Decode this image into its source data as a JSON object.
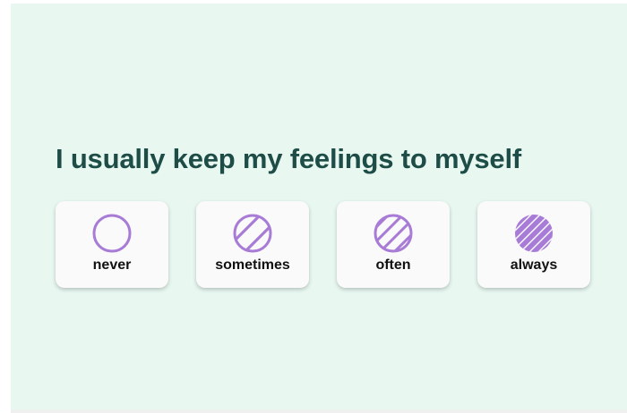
{
  "question": {
    "text": "I usually keep my feelings to myself"
  },
  "options": [
    {
      "label": "never",
      "icon": "empty-circle-icon",
      "fill_level": 0
    },
    {
      "label": "sometimes",
      "icon": "lightly-hatched-circle-icon",
      "fill_level": 1
    },
    {
      "label": "often",
      "icon": "hatched-circle-icon",
      "fill_level": 2
    },
    {
      "label": "always",
      "icon": "densely-hatched-circle-icon",
      "fill_level": 3
    }
  ],
  "colors": {
    "background": "#e8f8f1",
    "question_text": "#1e4d47",
    "accent": "#a77bd6",
    "card": "#fafafa"
  }
}
